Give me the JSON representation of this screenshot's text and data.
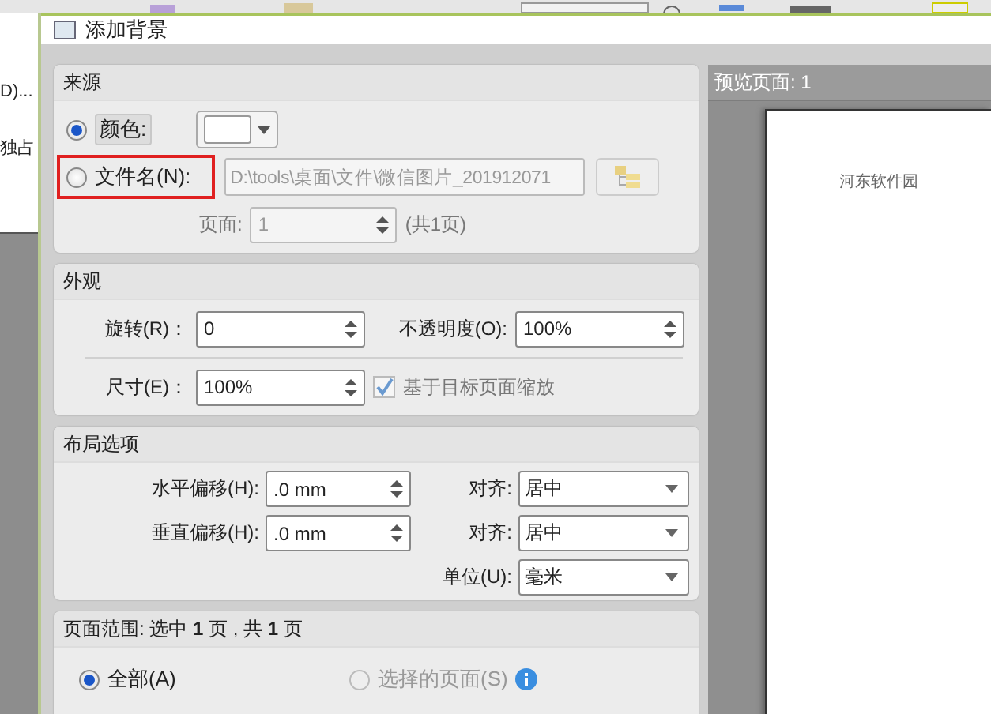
{
  "background_app": {
    "texts": [
      "D)...",
      "独占"
    ]
  },
  "window": {
    "title": "添加背景"
  },
  "source": {
    "title": "来源",
    "options": [
      {
        "label": "颜色:",
        "selected": true,
        "highlighted": false
      },
      {
        "label": "文件名(N):",
        "selected": false,
        "highlighted": true
      }
    ],
    "file_path": "D:\\tools\\桌面\\文件\\微信图片_201912071",
    "page_label": "页面:",
    "page_value": "1",
    "page_total": "(共1页)"
  },
  "appearance": {
    "title": "外观",
    "rotation": {
      "label": "旋转(R)：",
      "value": "0"
    },
    "opacity": {
      "label": "不透明度(O):",
      "value": "100%"
    },
    "size": {
      "label": "尺寸(E)：",
      "value": "100%"
    },
    "scale_to_page": {
      "label": "基于目标页面缩放",
      "checked": true
    }
  },
  "layout": {
    "title": "布局选项",
    "offsets": [
      {
        "label": "水平偏移(H):",
        "value": ".0 mm"
      },
      {
        "label": "垂直偏移(H):",
        "value": ".0 mm"
      }
    ],
    "dropdowns": [
      {
        "label": "对齐:",
        "value": "居中"
      },
      {
        "label": "对齐:",
        "value": "居中"
      },
      {
        "label": "单位(U):",
        "value": "毫米"
      }
    ]
  },
  "page_range": {
    "title": "页面范围: 选中 **1** 页 , 共 **1** 页",
    "options": [
      {
        "label": "全部(A)",
        "selected": true,
        "disabled": false
      },
      {
        "label": "选择的页面(S)",
        "selected": false,
        "disabled": true
      }
    ]
  },
  "preview": {
    "title": "预览页面: 1",
    "page_text": "河东软件园"
  }
}
